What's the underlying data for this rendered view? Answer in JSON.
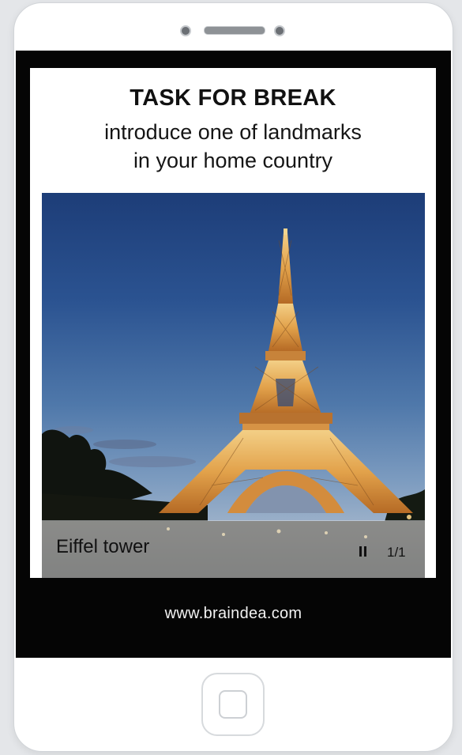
{
  "task": {
    "title": "TASK FOR BREAK",
    "line1": "introduce one of landmarks",
    "line2": "in your home country"
  },
  "slideshow": {
    "caption": "Eiffel tower",
    "counter": "1/1",
    "control_icon": "pause-icon"
  },
  "footer": {
    "website": "www.braindea.com"
  },
  "colors": {
    "screen_background": "#050505",
    "sky_top": "#1d3d78",
    "tower_light": "#e0a14a"
  }
}
